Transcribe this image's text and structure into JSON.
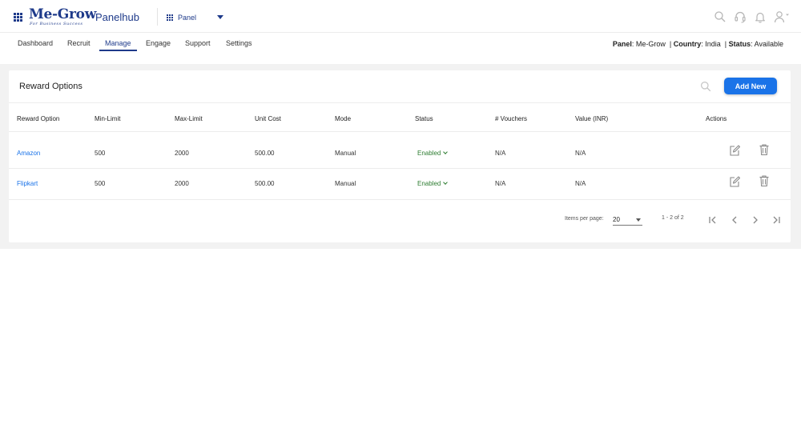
{
  "header": {
    "brand": "Me-Grow",
    "tagline": "For Business Success",
    "app_name": "Panelhub",
    "panel_selector": "Panel",
    "icons": [
      "search-icon",
      "headset-icon",
      "bell-icon",
      "user-icon"
    ]
  },
  "nav": {
    "tabs": [
      {
        "label": "Dashboard"
      },
      {
        "label": "Recruit"
      },
      {
        "label": "Manage",
        "active": true
      },
      {
        "label": "Engage"
      },
      {
        "label": "Support"
      },
      {
        "label": "Settings"
      }
    ],
    "status": {
      "panel_label": "Panel",
      "panel_value": "Me-Grow",
      "country_label": "Country",
      "country_value": "India",
      "status_label": "Status",
      "status_value": "Available"
    }
  },
  "card": {
    "title": "Reward Options",
    "add_button": "Add New",
    "columns": [
      "Reward Option",
      "Min-Limit",
      "Max-Limit",
      "Unit Cost",
      "Mode",
      "Status",
      "# Vouchers",
      "Value (INR)",
      "Actions"
    ],
    "rows": [
      {
        "reward_option": "Amazon",
        "min_limit": "500",
        "max_limit": "2000",
        "unit_cost": "500.00",
        "mode": "Manual",
        "status": "Enabled",
        "vouchers": "N/A",
        "value_inr": "N/A"
      },
      {
        "reward_option": "Flipkart",
        "min_limit": "500",
        "max_limit": "2000",
        "unit_cost": "500.00",
        "mode": "Manual",
        "status": "Enabled",
        "vouchers": "N/A",
        "value_inr": "N/A"
      }
    ]
  },
  "pagination": {
    "items_per_page_label": "Items per page:",
    "items_per_page": "20",
    "range": "1 - 2 of 2"
  },
  "colors": {
    "brand": "#1e3a8a",
    "accent": "#1a73e8",
    "enabled": "#2e7d32",
    "background": "#f2f2f2"
  }
}
